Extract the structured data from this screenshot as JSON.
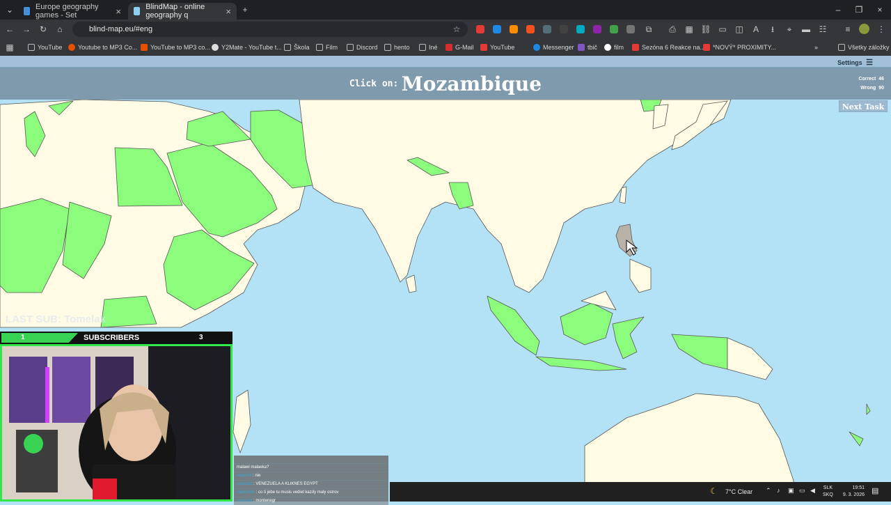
{
  "browser": {
    "tabs": [
      {
        "label": "Europe geography games - Set",
        "active": false
      },
      {
        "label": "BlindMap - online geography q",
        "active": true
      }
    ],
    "url": "blind-map.eu/#eng",
    "bookmarks": [
      "YouTube",
      "Youtube to MP3 Co...",
      "YouTube to MP3 co...",
      "Y2Mate - YouTube t...",
      "Škola",
      "Film",
      "Discord",
      "hento",
      "Iné",
      "G-Mail",
      "YouTube",
      "Messenger",
      "tbič",
      "film",
      "Sezóna 6 Reakce na...",
      "*NOVÝ* PROXIMITY..."
    ],
    "all_bookmarks": "Všetky záložky"
  },
  "site": {
    "settings_label": "Settings",
    "task_prefix": "Click on:",
    "task_country": "Mozambique",
    "correct_label": "Correct",
    "correct_value": "46",
    "wrong_label": "Wrong",
    "wrong_value": "90",
    "next_task": "Next Task"
  },
  "overlay": {
    "last_sub": "LAST SUB: Tomelak",
    "sub_goal_left": "1",
    "sub_label": "SUBSCRIBERS",
    "sub_goal_right": "3"
  },
  "chat": [
    {
      "user": "",
      "text": ""
    },
    {
      "user": "",
      "text": "malawi malaeka?"
    },
    {
      "user": "vanerzd",
      "text": "nie"
    },
    {
      "user": "vanezxd",
      "text": "VENEZUELA A KLIKNES EGYPT"
    },
    {
      "user": "markokolf",
      "text": "co ti jebe tu musis vediet kazdy maly ostrov"
    },
    {
      "user": "vanezxd",
      "text": "montenegr"
    }
  ],
  "taskbar": {
    "weather": "7°C  Clear",
    "lang_top": "SLK",
    "lang_bottom": "SKQ",
    "time": "19:51",
    "date": "9. 3. 2026"
  },
  "colors": {
    "land": "#fffbe4",
    "correct_land": "#8bfc7b",
    "sea": "#b3e1f5",
    "selected": "#b8b2a8",
    "border": "#555"
  }
}
